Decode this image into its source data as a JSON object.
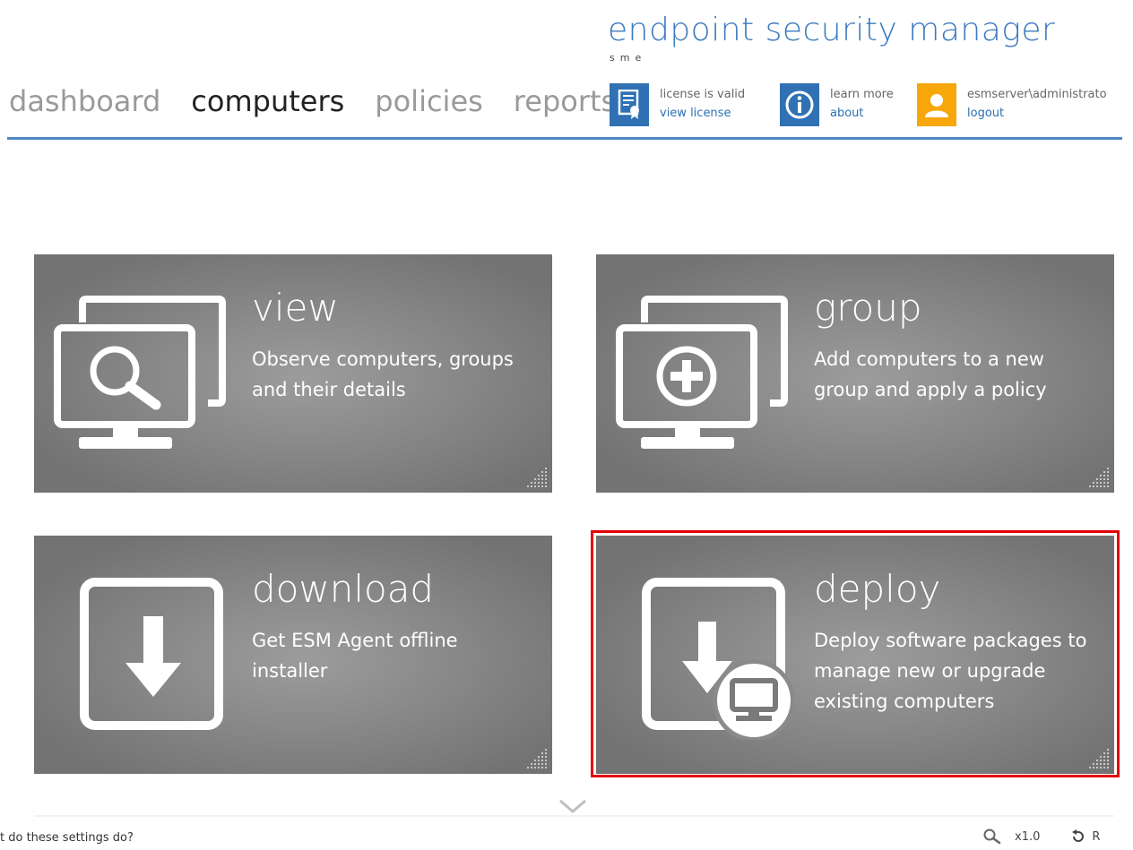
{
  "brand": {
    "title": "endpoint security manager",
    "subtitle": "sme"
  },
  "nav": {
    "items": [
      "dashboard",
      "computers",
      "policies",
      "reports"
    ],
    "active": "computers"
  },
  "header": {
    "license": {
      "status": "license is valid",
      "link": "view license",
      "icon": "certificate-icon"
    },
    "learn": {
      "text": "learn more",
      "link": "about",
      "icon": "info-icon"
    },
    "user": {
      "name": "esmserver\\administrato",
      "link": "logout",
      "icon": "user-icon"
    }
  },
  "tiles": [
    {
      "title": "view",
      "description": "Observe computers, groups and their details",
      "icon": "monitor-search-icon"
    },
    {
      "title": "group",
      "description": "Add computers to a new group and apply a policy",
      "icon": "monitor-plus-icon"
    },
    {
      "title": "download",
      "description": "Get ESM Agent offline installer",
      "icon": "download-icon"
    },
    {
      "title": "deploy",
      "description": "Deploy software packages to manage new or upgrade existing computers",
      "icon": "deploy-icon",
      "highlighted": true
    }
  ],
  "status": {
    "help_text": "t do these settings do?",
    "zoom": "x1.0",
    "reset_label": "R"
  },
  "colors": {
    "accent": "#3d7bbf",
    "tile_bg": "#8a8a8a",
    "highlight": "#e60000",
    "user_badge": "#f7a70a"
  }
}
